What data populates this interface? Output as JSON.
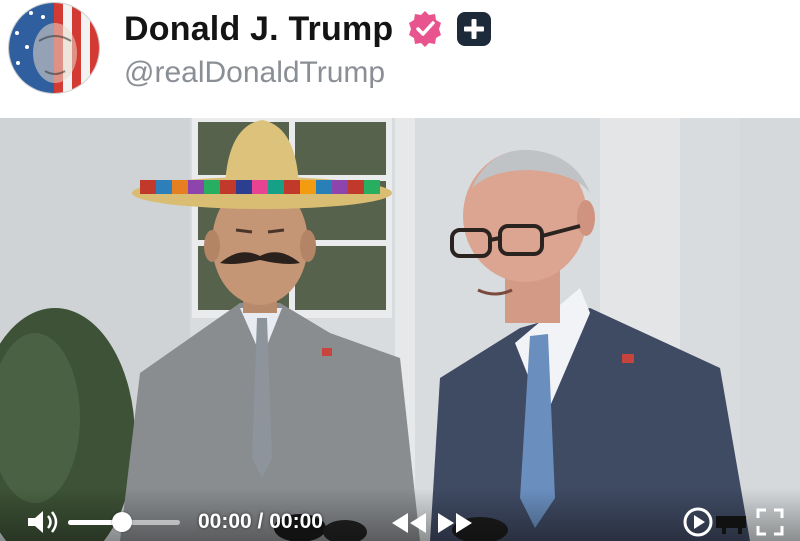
{
  "post": {
    "author_name": "Donald J. Trump",
    "handle": "@realDonaldTrump"
  },
  "icons": {
    "avatar": "flag-portrait-avatar",
    "verified": "verified-badge-icon",
    "follow": "plus-icon"
  },
  "colors": {
    "verified_badge": "#e8548d",
    "follow_badge": "#1d2a3a"
  },
  "video": {
    "time_display": "00:00 / 00:00",
    "volume_level": 0.48,
    "controls": [
      "volume-icon",
      "rewind-icon",
      "forward-icon",
      "play-icon",
      "cast-icon",
      "fullscreen-icon"
    ]
  }
}
